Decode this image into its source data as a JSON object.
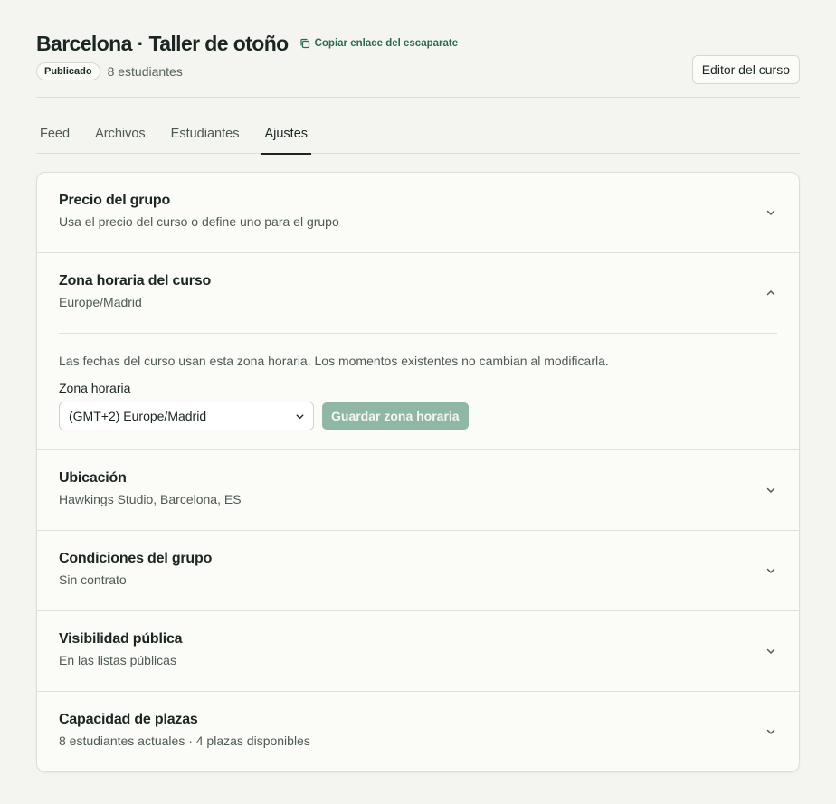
{
  "header": {
    "title": "Barcelona · Taller de otoño",
    "copy_link_label": "Copiar enlace del escaparate",
    "status_badge": "Publicado",
    "student_count": "8 estudiantes",
    "editor_button_label": "Editor del curso"
  },
  "tabs": [
    {
      "label": "Feed",
      "active": false
    },
    {
      "label": "Archivos",
      "active": false
    },
    {
      "label": "Estudiantes",
      "active": false
    },
    {
      "label": "Ajustes",
      "active": true
    }
  ],
  "settings": {
    "sections": [
      {
        "title": "Precio del grupo",
        "subtitle": "Usa el precio del curso o define uno para el grupo",
        "expanded": false
      },
      {
        "title": "Zona horaria del curso",
        "subtitle": "Europe/Madrid",
        "expanded": true
      },
      {
        "title": "Ubicación",
        "subtitle": "Hawkings Studio, Barcelona, ES",
        "expanded": false
      },
      {
        "title": "Condiciones del grupo",
        "subtitle": "Sin contrato",
        "expanded": false
      },
      {
        "title": "Visibilidad pública",
        "subtitle": "En las listas públicas",
        "expanded": false
      },
      {
        "title": "Capacidad de plazas",
        "subtitle": "8 estudiantes actuales · 4 plazas disponibles",
        "expanded": false
      }
    ],
    "timezone": {
      "help_text": "Las fechas del curso usan esta zona horaria. Los momentos existentes no cambian al modificarla.",
      "field_label": "Zona horaria",
      "selected_value": "(GMT+2) Europe/Madrid",
      "save_button_label": "Guardar zona horaria",
      "save_disabled": true
    }
  },
  "colors": {
    "page_background": "#f4f5f0",
    "card_background": "#fbfbf8",
    "accent_green": "#2a6a4e",
    "disabled_button": "#8fb7a3",
    "text_primary": "#1b2623",
    "text_secondary": "#4f5a55"
  },
  "icons": {
    "copy": "copy-icon",
    "chevron_down": "chevron-down-icon",
    "chevron_up": "chevron-up-icon"
  }
}
